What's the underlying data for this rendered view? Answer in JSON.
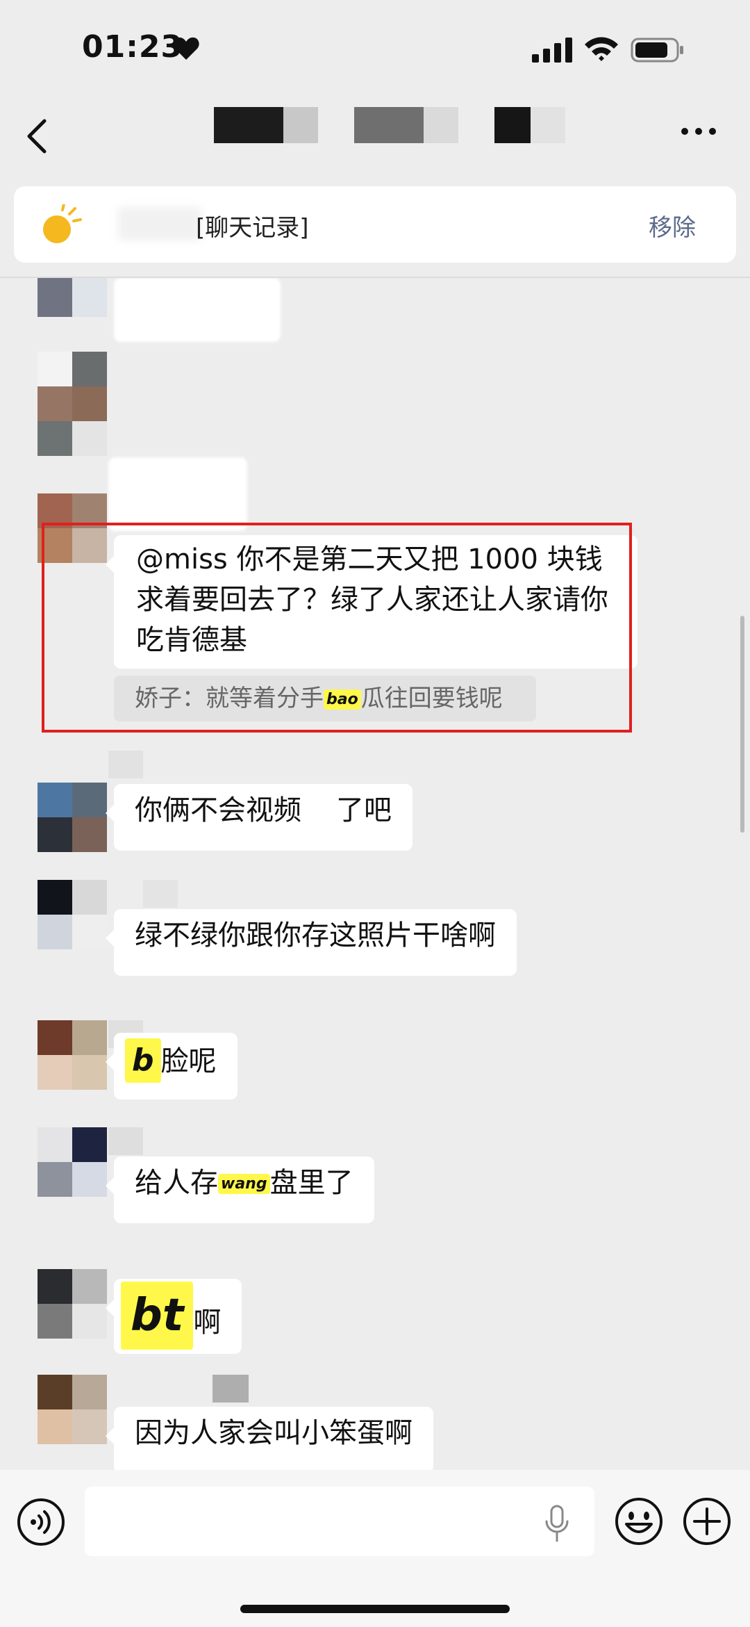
{
  "status_bar": {
    "time": "01:23"
  },
  "pinned": {
    "label": "[聊天记录]",
    "remove": "移除"
  },
  "messages": [
    {
      "text": "@miss 你不是第二天又把 1000 块钱求着要回去了？绿了人家还让人家请你吃肯德基",
      "quote_prefix": "娇子：就等着分手",
      "quote_hl": "bao",
      "quote_suffix": "瓜往回要钱呢"
    },
    {
      "text_a": "你俩不会视频",
      "text_b": "了吧"
    },
    {
      "text": "绿不绿你跟你存这照片干啥啊"
    },
    {
      "hl": "b",
      "text": "脸呢"
    },
    {
      "text_a": "给人存",
      "hl": "wang",
      "text_b": "盘里了"
    },
    {
      "hl": "bt",
      "text": "啊"
    },
    {
      "text": "因为人家会叫小笨蛋啊"
    }
  ],
  "colors": {
    "highlight": "#fff84a",
    "annotation_box": "#e0201f",
    "link_gray": "#5b6b8a"
  }
}
